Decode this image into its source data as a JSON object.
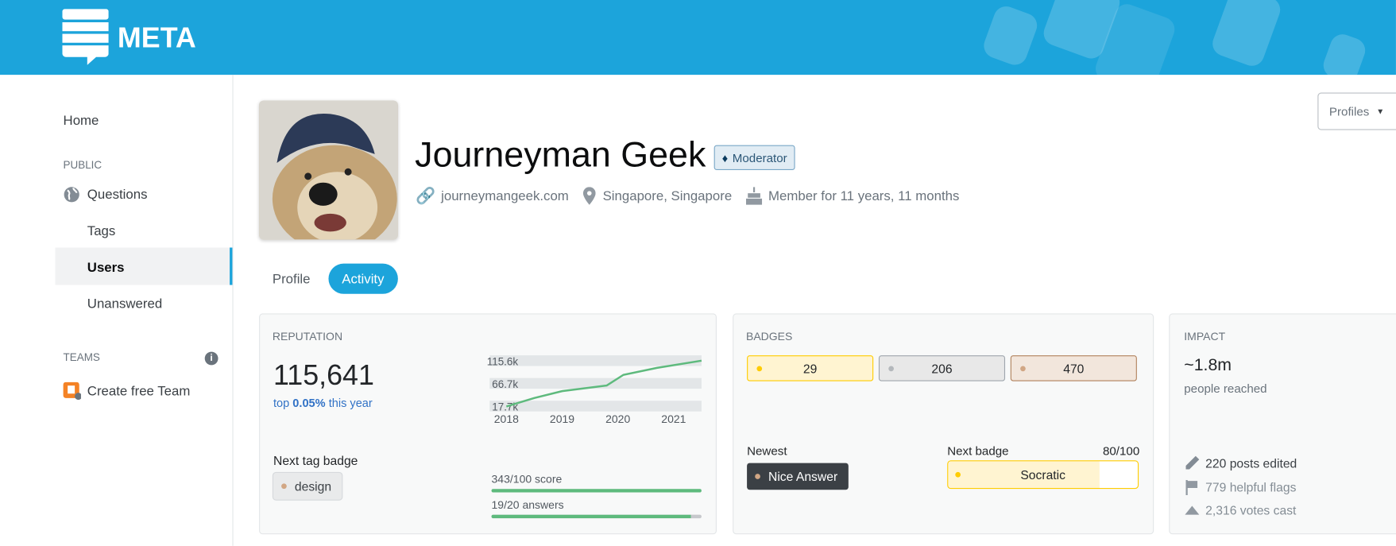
{
  "header": {
    "logo_text": "META"
  },
  "sidebar": {
    "home": "Home",
    "public_label": "PUBLIC",
    "questions": "Questions",
    "tags": "Tags",
    "users": "Users",
    "unanswered": "Unanswered",
    "teams_label": "TEAMS",
    "create_team": "Create free Team"
  },
  "profile": {
    "name": "Journeyman Geek",
    "role_badge": "Moderator",
    "website": "journeymangeek.com",
    "location": "Singapore, Singapore",
    "member_for": "Member for 11 years, 11 months",
    "profiles_button": "Profiles"
  },
  "tabs": [
    {
      "label": "Profile",
      "active": false
    },
    {
      "label": "Activity",
      "active": true
    }
  ],
  "reputation": {
    "title": "REPUTATION",
    "value": "115,641",
    "rank_prefix": "top",
    "rank_value": "0.05%",
    "rank_suffix": "this year",
    "next_tag_label": "Next tag badge",
    "next_tag": "design",
    "score_progress": "343/100 score",
    "score_fraction": 1.0,
    "answers_progress": "19/20 answers",
    "answers_fraction": 0.95
  },
  "chart_data": {
    "type": "line",
    "x_ticks": [
      "2018",
      "2019",
      "2020",
      "2021"
    ],
    "y_ticks": [
      "115.6k",
      "66.7k",
      "17.7k"
    ],
    "y_tick_values": [
      115.6,
      66.7,
      17.7
    ],
    "xlim": [
      2017.7,
      2021.5
    ],
    "ylim": [
      17.7,
      115.6
    ],
    "x": [
      2018.0,
      2018.5,
      2019.0,
      2019.8,
      2020.1,
      2020.7,
      2021.5
    ],
    "y": [
      17.0,
      35,
      50,
      62,
      85,
      100,
      115.6
    ],
    "color": "#5eba7d"
  },
  "badges": {
    "title": "BADGES",
    "gold": "29",
    "silver": "206",
    "bronze": "470",
    "newest_label": "Newest",
    "newest": "Nice Answer",
    "next_label": "Next badge",
    "next_progress": "80/100",
    "next_fraction": 0.8,
    "next_badge": "Socratic"
  },
  "impact": {
    "title": "IMPACT",
    "reach": "~1.8m",
    "reach_label": "people reached",
    "posts_edited": "220 posts edited",
    "helpful_flags": "779 helpful flags",
    "votes_cast": "2,316 votes cast"
  },
  "colors": {
    "accent": "#1ca4db",
    "gold": "#ffcc01",
    "silver": "#b4b8bc",
    "bronze": "#d1a684",
    "link": "#3172c6"
  }
}
